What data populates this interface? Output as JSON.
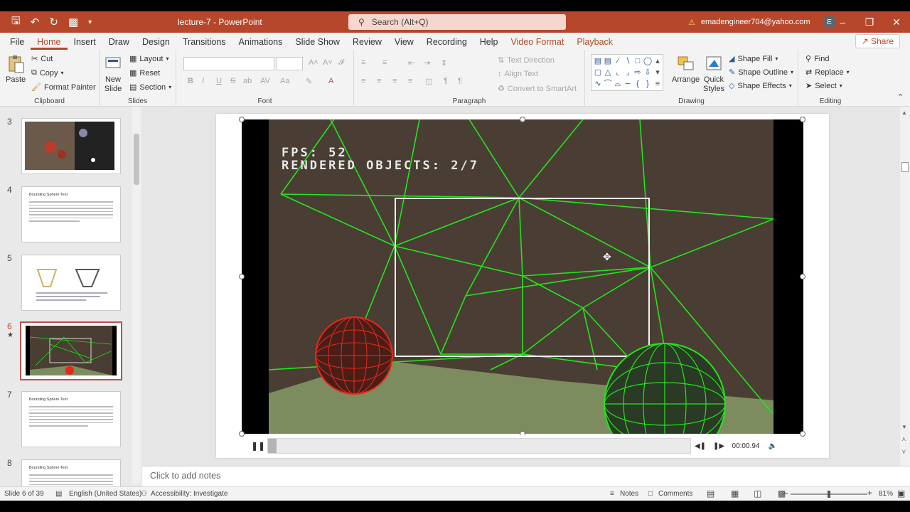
{
  "titlebar": {
    "doc_title": "lecture-7  -  PowerPoint",
    "search_placeholder": "Search (Alt+Q)",
    "account_email": "emadengineer704@yahoo.com",
    "avatar_initial": "E"
  },
  "menu": {
    "tabs": [
      "File",
      "Home",
      "Insert",
      "Draw",
      "Design",
      "Transitions",
      "Animations",
      "Slide Show",
      "Review",
      "View",
      "Recording",
      "Help",
      "Video Format",
      "Playback"
    ],
    "share_label": "Share"
  },
  "ribbon": {
    "clipboard": {
      "paste": "Paste",
      "cut": "Cut",
      "copy": "Copy",
      "format_painter": "Format Painter",
      "label": "Clipboard"
    },
    "slides": {
      "new_slide_1": "New",
      "new_slide_2": "Slide",
      "layout": "Layout",
      "reset": "Reset",
      "section": "Section",
      "label": "Slides"
    },
    "font": {
      "label": "Font",
      "bold": "B",
      "italic": "I",
      "underline": "U",
      "strike": "S",
      "shadow": "ab",
      "spacing": "AV",
      "case": "Aa"
    },
    "paragraph": {
      "label": "Paragraph",
      "text_direction": "Text Direction",
      "align_text": "Align Text",
      "convert_smartart": "Convert to SmartArt"
    },
    "drawing": {
      "label": "Drawing",
      "arrange": "Arrange",
      "quick_styles_1": "Quick",
      "quick_styles_2": "Styles",
      "shape_fill": "Shape Fill",
      "shape_outline": "Shape Outline",
      "shape_effects": "Shape Effects"
    },
    "editing": {
      "label": "Editing",
      "find": "Find",
      "replace": "Replace",
      "select": "Select"
    }
  },
  "slides_panel": [
    {
      "num": "3",
      "title": ""
    },
    {
      "num": "4",
      "title": "Bounding Sphere Test"
    },
    {
      "num": "5",
      "title": ""
    },
    {
      "num": "6",
      "title": "",
      "active": true
    },
    {
      "num": "7",
      "title": "Bounding Sphere Test"
    },
    {
      "num": "8",
      "title": "Bounding Sphere Test"
    }
  ],
  "video": {
    "hud_fps": "FPS: 52",
    "hud_rendered": "RENDERED OBJECTS: 2/7",
    "time": "00:00.94",
    "progress": 0.02
  },
  "notes_placeholder": "Click to add notes",
  "status": {
    "slide_info": "Slide 6 of 39",
    "language": "English (United States)",
    "accessibility": "Accessibility: Investigate",
    "notes": "Notes",
    "comments": "Comments",
    "zoom": "81%"
  },
  "colors": {
    "accent": "#b7472a",
    "wire_green": "#22e51b",
    "wire_red": "#e8281b",
    "video_bg": "#4a3e34",
    "floor": "#7c8c5e"
  }
}
